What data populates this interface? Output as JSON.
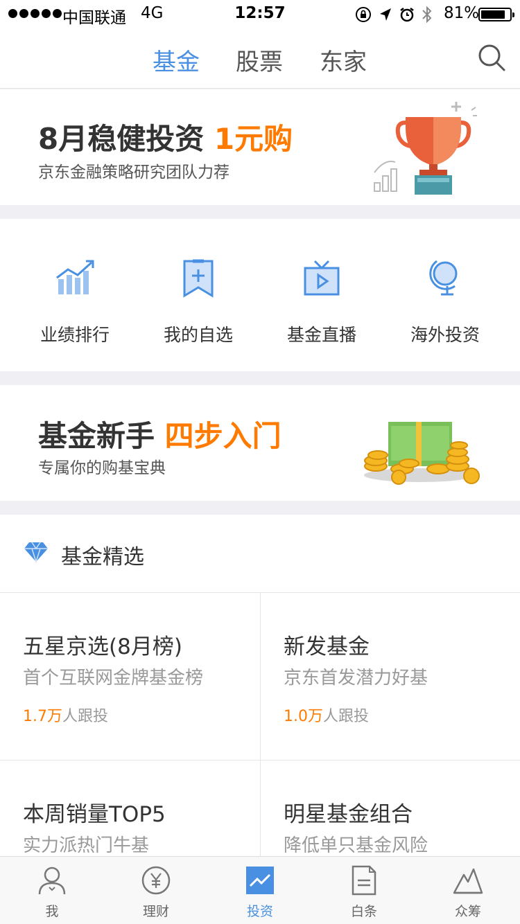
{
  "status_bar": {
    "carrier": "中国联通",
    "network": "4G",
    "time": "12:57",
    "battery": "81%",
    "battery_level": 0.81
  },
  "nav": {
    "tabs": [
      "基金",
      "股票",
      "东家"
    ],
    "active_tab": "基金",
    "accent": "#4a90e2"
  },
  "banner_invest": {
    "title": "8月稳健投资",
    "highlight": "1元购",
    "subtitle": "京东金融策略研究团队力荐"
  },
  "quick_menu": [
    {
      "label": "业绩排行",
      "icon": "trend-chart-icon"
    },
    {
      "label": "我的自选",
      "icon": "bookmark-plus-icon"
    },
    {
      "label": "基金直播",
      "icon": "tv-play-icon"
    },
    {
      "label": "海外投资",
      "icon": "globe-icon"
    }
  ],
  "banner_newbie": {
    "title": "基金新手",
    "highlight": "四步入门",
    "subtitle": "专属你的购基宝典"
  },
  "fund_picks": {
    "header": "基金精选",
    "cards": [
      {
        "title": "五星京选(8月榜)",
        "subtitle": "首个互联网金牌基金榜",
        "followers_num": "1.7万",
        "followers_suffix": "人跟投"
      },
      {
        "title": "新发基金",
        "subtitle": "京东首发潜力好基",
        "followers_num": "1.0万",
        "followers_suffix": "人跟投"
      },
      {
        "title": "本周销量TOP5",
        "subtitle": "实力派热门牛基"
      },
      {
        "title": "明星基金组合",
        "subtitle": "降低单只基金风险"
      }
    ]
  },
  "tab_bar": {
    "items": [
      "我",
      "理财",
      "投资",
      "白条",
      "众筹"
    ],
    "active": "投资"
  },
  "colors": {
    "highlight": "#ff7a00",
    "accent": "#4a90e2"
  }
}
